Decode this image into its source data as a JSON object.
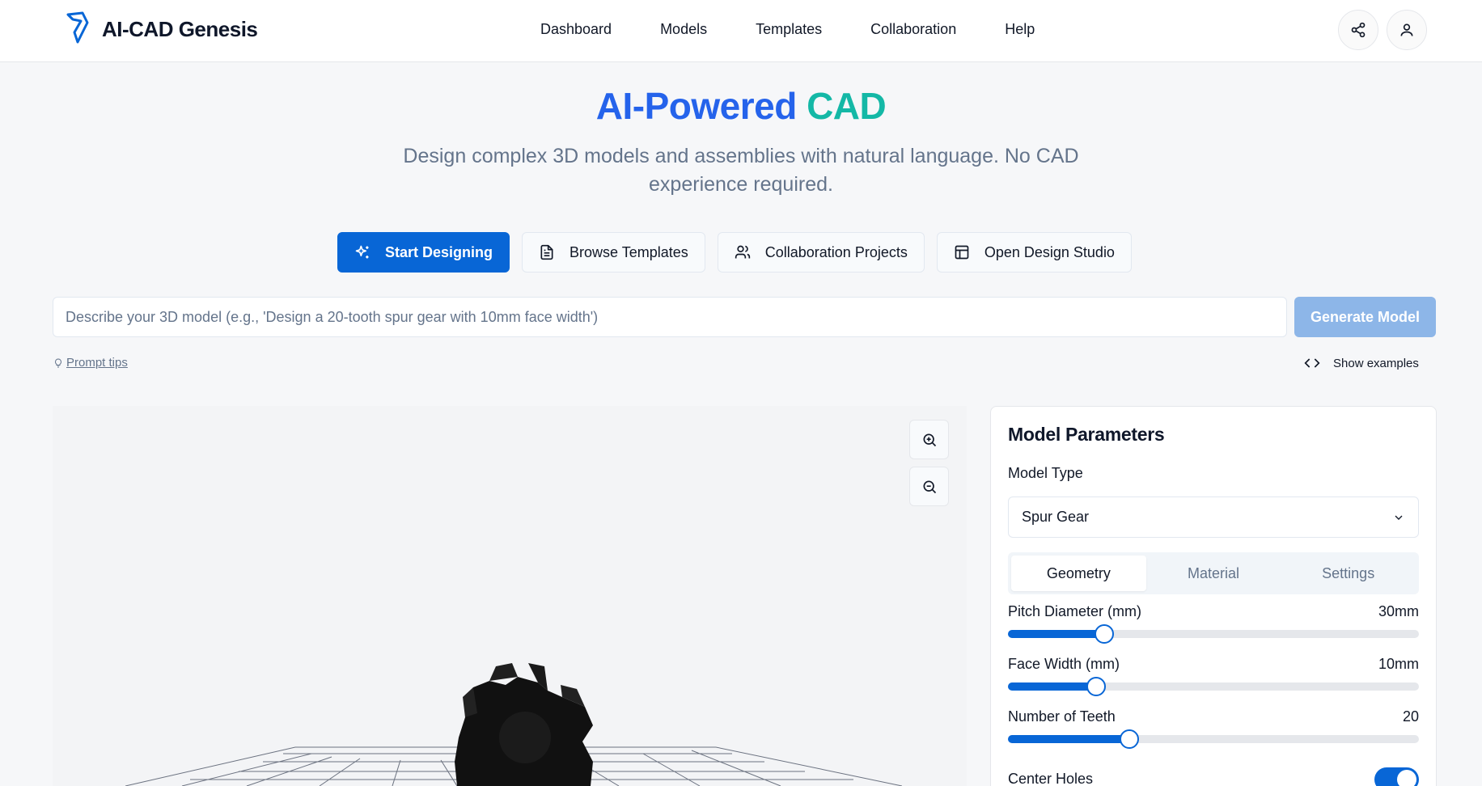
{
  "header": {
    "brand": "AI-CAD Genesis",
    "nav": [
      "Dashboard",
      "Models",
      "Templates",
      "Collaboration",
      "Help"
    ]
  },
  "hero": {
    "title_part1": "AI-Powered",
    "title_part2": "CAD",
    "subtitle": "Design complex 3D models and assemblies with natural language. No CAD experience required."
  },
  "actions": {
    "start": "Start Designing",
    "browse": "Browse Templates",
    "collab": "Collaboration Projects",
    "studio": "Open Design Studio"
  },
  "prompt": {
    "placeholder": "Describe your 3D model (e.g., 'Design a 20-tooth spur gear with 10mm face width')",
    "value": "",
    "generate": "Generate Model",
    "tips": "Prompt tips",
    "show_examples": "Show examples"
  },
  "panel": {
    "title": "Model Parameters",
    "model_type_label": "Model Type",
    "model_type_value": "Spur Gear",
    "tabs": [
      "Geometry",
      "Material",
      "Settings"
    ],
    "active_tab": "Geometry",
    "params": [
      {
        "label": "Pitch Diameter (mm)",
        "value": "30mm",
        "fraction": 0.235
      },
      {
        "label": "Face Width (mm)",
        "value": "10mm",
        "fraction": 0.215
      },
      {
        "label": "Number of Teeth",
        "value": "20",
        "fraction": 0.295
      }
    ],
    "center_holes_label": "Center Holes",
    "center_holes_on": true
  },
  "colors": {
    "primary": "#0866d6",
    "title_blue": "#2563eb",
    "title_teal": "#14b8a6"
  }
}
